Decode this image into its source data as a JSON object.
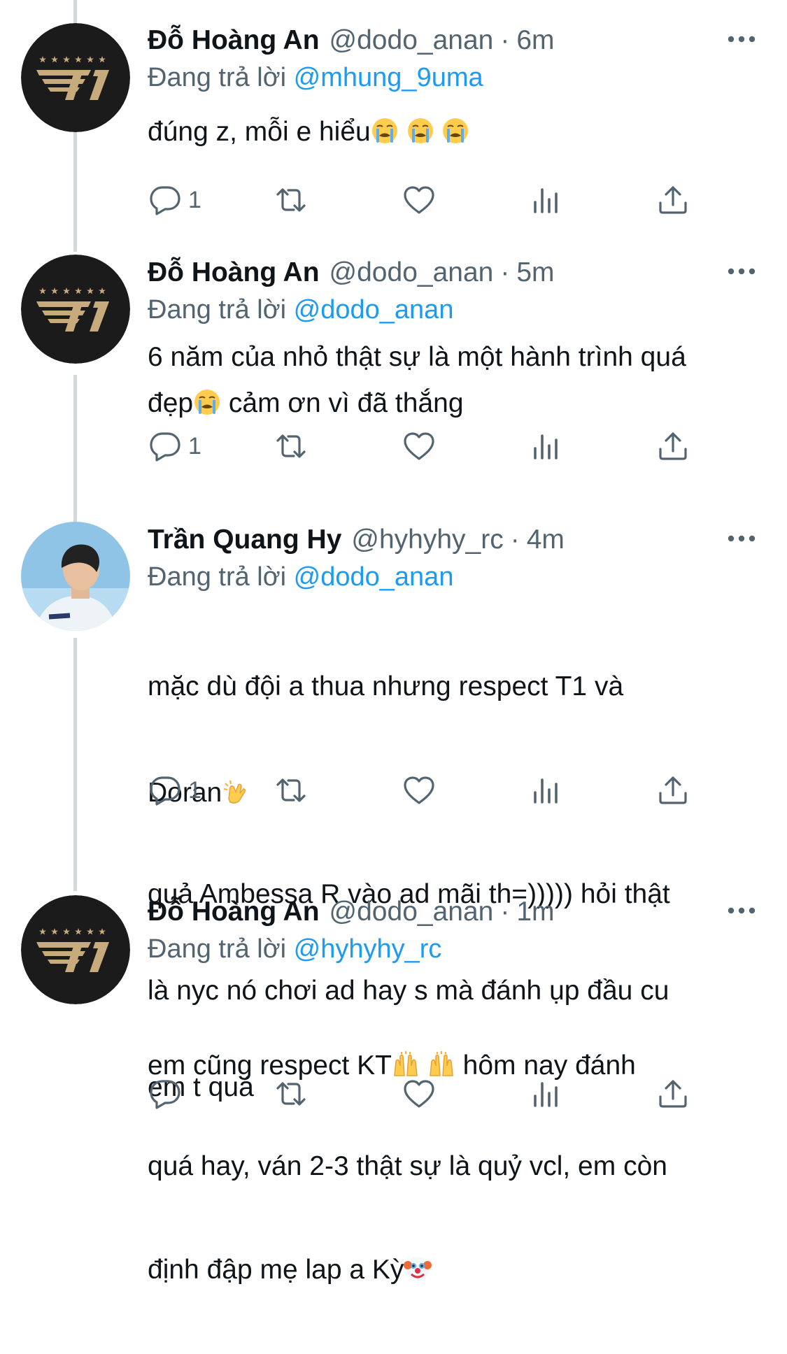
{
  "thread": {
    "tweets": [
      {
        "name": "Đỗ Hoàng An",
        "handle": "@dodo_anan",
        "separator": "·",
        "time": "6m",
        "replying_prefix": "Đang trả lời",
        "replying_to": "@mhung_9uma",
        "text_1": "đúng z, mỗi e hiểu",
        "reply_count": "1",
        "avatar_icon": "t1-logo-icon",
        "emojis": [
          "loudly-crying-face",
          "loudly-crying-face",
          "loudly-crying-face"
        ]
      },
      {
        "name": "Đỗ Hoàng An",
        "handle": "@dodo_anan",
        "separator": "·",
        "time": "5m",
        "replying_prefix": "Đang trả lời",
        "replying_to": "@dodo_anan",
        "text_1": "6 năm của nhỏ thật sự là một hành trình quá",
        "text_2": "đẹp",
        "text_3": " cảm ơn vì đã thắng",
        "reply_count": "1",
        "avatar_icon": "t1-logo-icon",
        "emojis": [
          "loudly-crying-face"
        ]
      },
      {
        "name": "Trần Quang Hy",
        "handle": "@hyhyhy_rc",
        "separator": "·",
        "time": "4m",
        "replying_prefix": "Đang trả lời",
        "replying_to": "@dodo_anan",
        "text_1": "mặc dù đội a thua nhưng respect T1 và",
        "text_2": "Doran",
        "text_3": "quả Ambessa R vào ad mãi th=))))) hỏi thật",
        "text_4": "là nyc nó chơi ad hay s mà đánh ụp đầu cu",
        "text_5": "em t quá",
        "reply_count": "1",
        "avatar_icon": "profile-photo",
        "emojis": [
          "clapping-hands"
        ]
      },
      {
        "name": "Đỗ Hoàng An",
        "handle": "@dodo_anan",
        "separator": "·",
        "time": "1m",
        "replying_prefix": "Đang trả lời",
        "replying_to": "@hyhyhy_rc",
        "text_1": "em cũng respect KT",
        "text_2": " hôm nay đánh",
        "text_3": "quá hay, ván 2-3 thật sự là quỷ vcl, em còn",
        "text_4": "định đập mẹ lap a Kỳ",
        "reply_count": "",
        "avatar_icon": "t1-logo-icon",
        "emojis": [
          "raising-hands",
          "raising-hands",
          "clown-face"
        ]
      }
    ]
  },
  "icons": {
    "more": "more-icon",
    "reply": "reply-icon",
    "retweet": "retweet-icon",
    "like": "like-icon",
    "views": "views-icon",
    "share": "share-icon"
  },
  "colors": {
    "text": "#0f1419",
    "secondary": "#536471",
    "mention": "#1d9bf0",
    "thread_line": "#cfd9de",
    "t1_gold": "#c8ab7c",
    "t1_background": "#1b1b1b"
  }
}
